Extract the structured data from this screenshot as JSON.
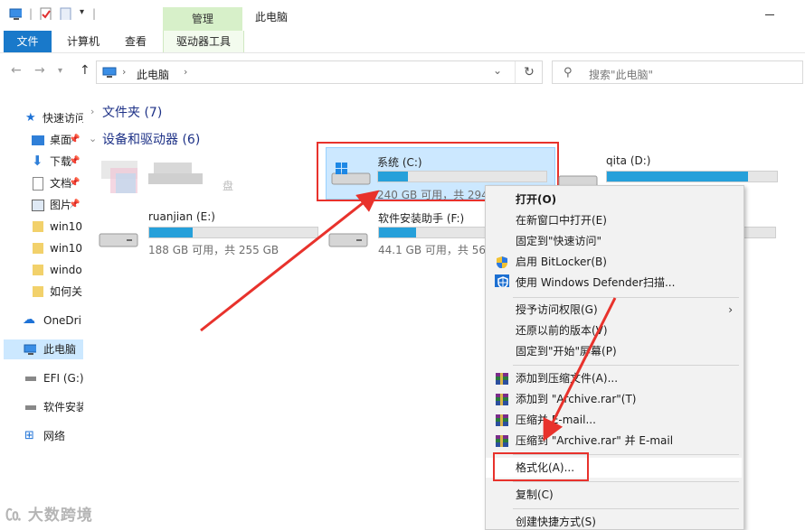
{
  "window": {
    "title": "此电脑",
    "contextual_tab_header": "管理"
  },
  "ribbon_tabs": [
    {
      "label": "文件"
    },
    {
      "label": "计算机"
    },
    {
      "label": "查看"
    },
    {
      "label": "驱动器工具"
    }
  ],
  "address": {
    "path": "此电脑",
    "search_placeholder": "搜索\"此电脑\""
  },
  "sidebar": {
    "items": [
      {
        "label": "快速访问",
        "icon": "star-icon"
      },
      {
        "label": "桌面",
        "icon": "desktop-icon"
      },
      {
        "label": "下载",
        "icon": "download-icon"
      },
      {
        "label": "文档",
        "icon": "document-icon"
      },
      {
        "label": "图片",
        "icon": "pictures-icon"
      },
      {
        "label": "win10",
        "icon": "folder-icon"
      },
      {
        "label": "win10",
        "icon": "folder-icon"
      },
      {
        "label": "windo",
        "icon": "folder-icon"
      },
      {
        "label": "如何关",
        "icon": "folder-icon"
      },
      {
        "label": "OneDri",
        "icon": "cloud-icon"
      },
      {
        "label": "此电脑",
        "icon": "pc-icon"
      },
      {
        "label": "EFI (G:)",
        "icon": "drive-icon"
      },
      {
        "label": "软件安装",
        "icon": "drive-icon"
      },
      {
        "label": "网络",
        "icon": "network-icon"
      }
    ]
  },
  "groups": {
    "folders": "文件夹 (7)",
    "devices": "设备和驱动器 (6)"
  },
  "drives": {
    "c": {
      "name": "系统 (C:)",
      "info": "240 GB 可用，共 294",
      "used_fraction": 0.18
    },
    "d": {
      "name": "qita (D:)",
      "info": "",
      "used_fraction": 0.83
    },
    "e": {
      "name": "ruanjian (E:)",
      "info": "188 GB 可用，共 255 GB",
      "used_fraction": 0.26
    },
    "f": {
      "name": "软件安装助手 (F:)",
      "info": "44.1 GB 可用，共 56.",
      "used_fraction": 0.22
    },
    "blurred_suffix": "盘"
  },
  "context_menu": {
    "items": {
      "open": "打开(O)",
      "open_new_window": "在新窗口中打开(E)",
      "pin_quick_access": "固定到\"快速访问\"",
      "bitlocker": "启用 BitLocker(B)",
      "defender": "使用 Windows Defender扫描...",
      "grant_access": "授予访问权限(G)",
      "restore_versions": "还原以前的版本(V)",
      "pin_start": "固定到\"开始\"屏幕(P)",
      "add_archive": "添加到压缩文件(A)...",
      "add_archive_rar": "添加到 \"Archive.rar\"(T)",
      "compress_email": "压缩并 E-mail...",
      "compress_rar_email": "压缩到 \"Archive.rar\" 并 E-mail",
      "format": "格式化(A)...",
      "copy": "复制(C)",
      "create_shortcut": "创建快捷方式(S)"
    }
  },
  "watermark": "大数跨境",
  "colors": {
    "accent": "#1979ca",
    "selection": "#cce8ff",
    "bar_fill": "#26a0da",
    "annotation_red": "#e8322c",
    "manage_tab": "#d7f0c9"
  }
}
